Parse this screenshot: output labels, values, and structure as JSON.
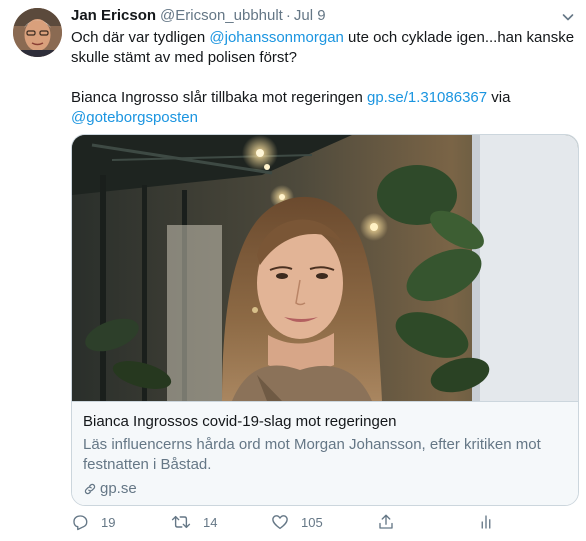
{
  "tweet": {
    "author_name": "Jan Ericson",
    "author_handle": "@Ericson_ubbhult",
    "separator": "·",
    "date": "Jul 9",
    "text_line1_before": "Och där var tydligen ",
    "mention_1": "@johanssonmorgan",
    "text_line1_after": " ute och cyklade igen...han kanske skulle stämt av med polisen först?",
    "text_line2_before": "Bianca Ingrosso slår tillbaka mot regeringen ",
    "link_url": "gp.se/1.31086367",
    "text_line2_via": " via",
    "mention_2": "@goteborgsposten"
  },
  "card": {
    "title": "Bianca Ingrossos covid-19-slag mot regeringen",
    "description": "Läs influencerns hårda ord mot Morgan Johansson, efter kritiken mot festnatten i Båstad.",
    "domain": "gp.se"
  },
  "actions": {
    "reply_count": "19",
    "retweet_count": "14",
    "like_count": "105"
  },
  "icons": {
    "chevron": "chevron-down-icon",
    "link": "link-icon",
    "reply": "reply-icon",
    "retweet": "retweet-icon",
    "like": "heart-icon",
    "share": "share-icon",
    "analytics": "analytics-icon"
  },
  "colors": {
    "link": "#1b95e0",
    "secondary_text": "#657786",
    "primary_text": "#14171a",
    "border": "#ccd6dd",
    "card_bg": "#f5f8fa"
  }
}
